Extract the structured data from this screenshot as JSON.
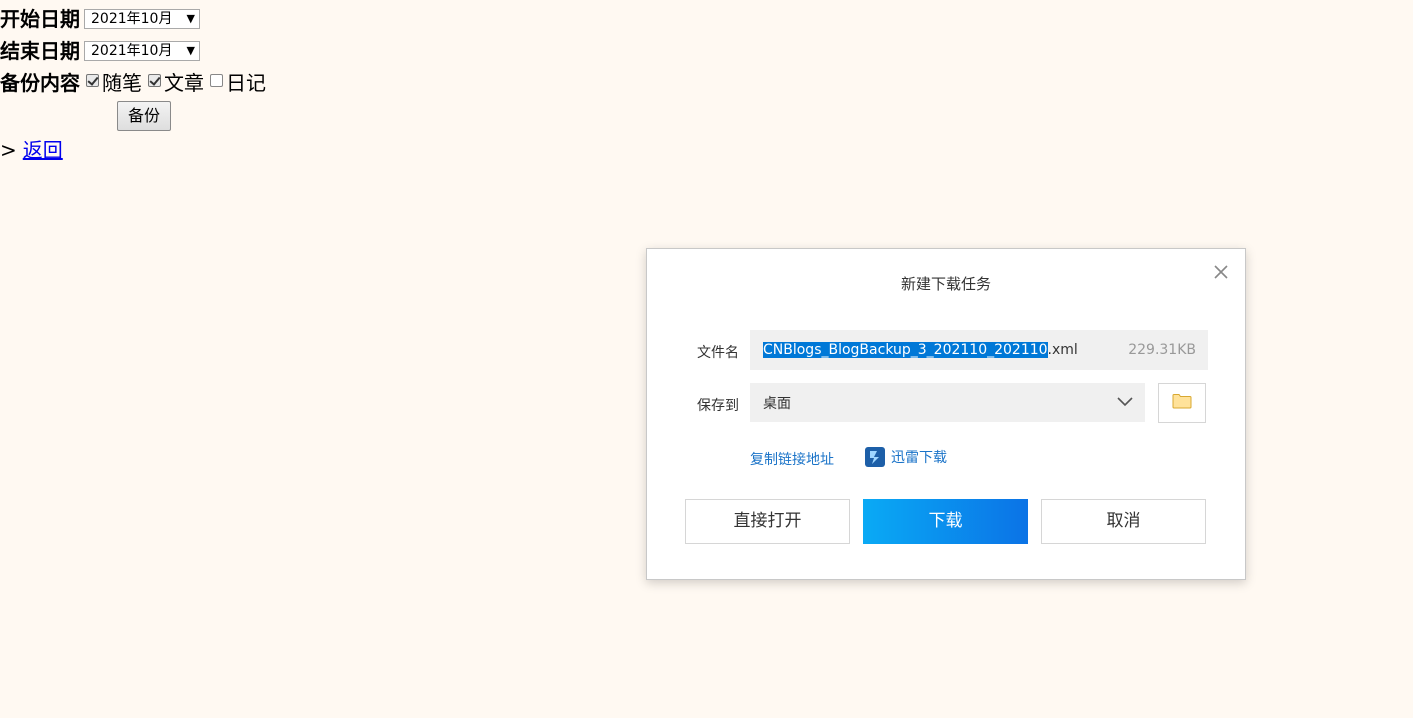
{
  "form": {
    "start_label": "开始日期",
    "start_value": "2021年10月",
    "end_label": "结束日期",
    "end_value": "2021年10月",
    "content_label": "备份内容",
    "options": [
      {
        "label": "随笔",
        "checked": true
      },
      {
        "label": "文章",
        "checked": true
      },
      {
        "label": "日记",
        "checked": false
      }
    ],
    "backup_button": "备份",
    "back_prefix": ">",
    "back_link": "返回"
  },
  "dialog": {
    "title": "新建下载任务",
    "filename_label": "文件名",
    "filename_selected": "CNBlogs_BlogBackup_3_202110_202110",
    "filename_ext": ".xml",
    "file_size": "229.31KB",
    "save_label": "保存到",
    "save_location": "桌面",
    "copy_link": "复制链接地址",
    "thunder_download": "迅雷下载",
    "open_button": "直接打开",
    "download_button": "下载",
    "cancel_button": "取消",
    "accent_color": "#0b73e6",
    "link_color": "#1a73c8"
  },
  "icons": {
    "close": "close-icon",
    "dropdown": "chevron-down-icon",
    "folder": "folder-icon",
    "thunder": "thunder-icon"
  }
}
